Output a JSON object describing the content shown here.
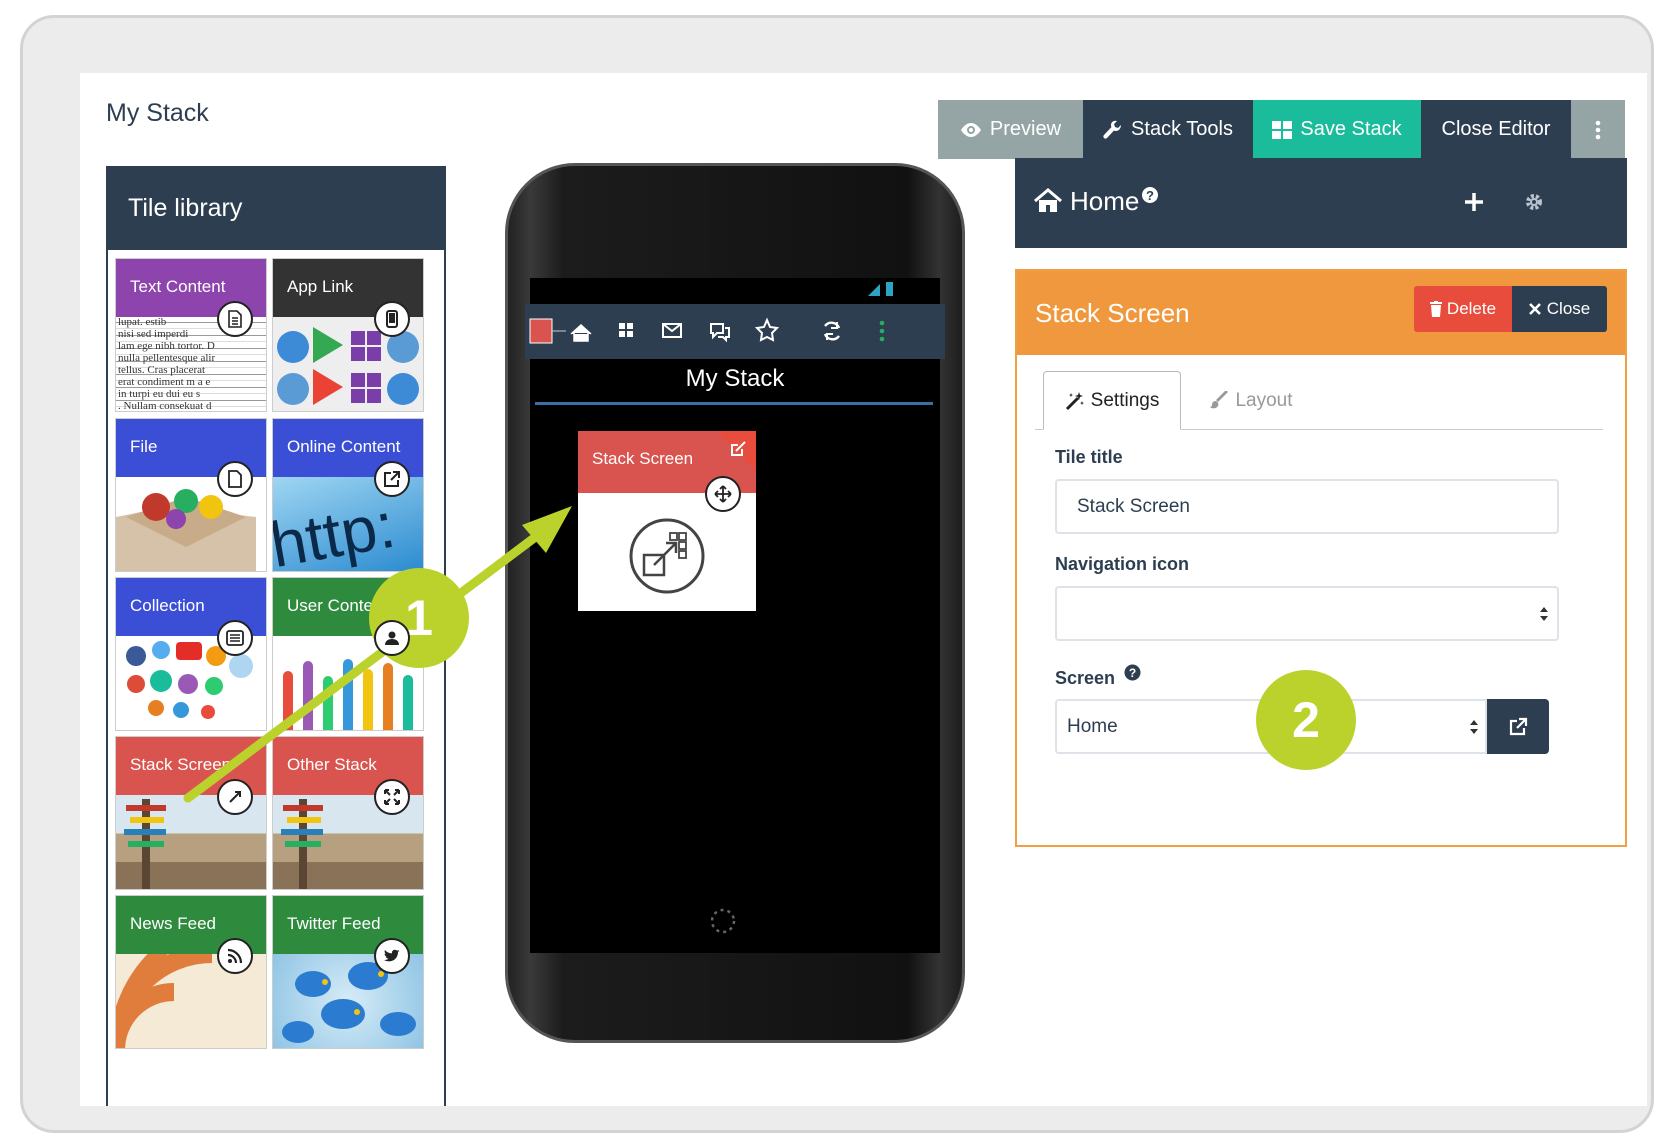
{
  "page": {
    "title": "My Stack"
  },
  "toolbar": {
    "preview": "Preview",
    "stack_tools": "Stack Tools",
    "save_stack": "Save Stack",
    "close_editor": "Close Editor"
  },
  "library": {
    "title": "Tile library",
    "tiles": [
      {
        "label": "Text Content",
        "color": "#8e44ad",
        "icon": "document-icon"
      },
      {
        "label": "App Link",
        "color": "#333333",
        "icon": "mobile-icon"
      },
      {
        "label": "File",
        "color": "#3b4fd6",
        "icon": "file-icon"
      },
      {
        "label": "Online Content",
        "color": "#3b4fd6",
        "icon": "external-link-icon"
      },
      {
        "label": "Collection",
        "color": "#3b4fd6",
        "icon": "list-icon"
      },
      {
        "label": "User Content",
        "color": "#2e8b3e",
        "icon": "user-icon"
      },
      {
        "label": "Stack Screen",
        "color": "#d9534f",
        "icon": "link-icon"
      },
      {
        "label": "Other Stack",
        "color": "#d9534f",
        "icon": "expand-icon"
      },
      {
        "label": "News Feed",
        "color": "#2e8b3e",
        "icon": "rss-icon"
      },
      {
        "label": "Twitter Feed",
        "color": "#2e8b3e",
        "icon": "twitter-icon"
      }
    ]
  },
  "phone": {
    "title": "My Stack",
    "tile_label": "Stack Screen"
  },
  "home_bar": {
    "title": "Home"
  },
  "stack_panel": {
    "title": "Stack Screen",
    "delete": "Delete",
    "close": "Close",
    "tab_settings": "Settings",
    "tab_layout": "Layout",
    "tile_title_label": "Tile title",
    "tile_title_value": "Stack Screen",
    "nav_icon_label": "Navigation icon",
    "nav_icon_value": "",
    "screen_label": "Screen",
    "screen_value": "Home"
  },
  "callouts": {
    "one": "1",
    "two": "2"
  },
  "colors": {
    "navy": "#2c3e50",
    "teal": "#1abc9c",
    "orange": "#f0983e",
    "red": "#e74c3c",
    "lime": "#bcd22c"
  }
}
